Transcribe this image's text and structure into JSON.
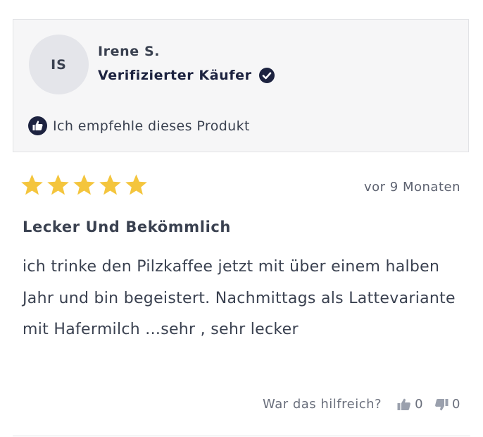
{
  "reviewer": {
    "initials": "IS",
    "name": "Irene S.",
    "verified_label": "Verifizierter Käufer",
    "recommend_text": "Ich empfehle dieses Produkt"
  },
  "review": {
    "rating": 5,
    "rating_max": 5,
    "date": "vor 9 Monaten",
    "title": "Lecker Und Bekömmlich",
    "body": "ich trinke den Pilzkaffee jetzt mit über einem halben Jahr und bin begeistert. Nachmittags als Lattevariante mit Hafermilch ...sehr , sehr lecker"
  },
  "helpful": {
    "question": "War das hilfreich?",
    "up_count": "0",
    "down_count": "0"
  },
  "colors": {
    "star": "#f4c53d",
    "dark_navy": "#1d2340",
    "text": "#3a4150",
    "box_bg": "#f6f6f7"
  }
}
